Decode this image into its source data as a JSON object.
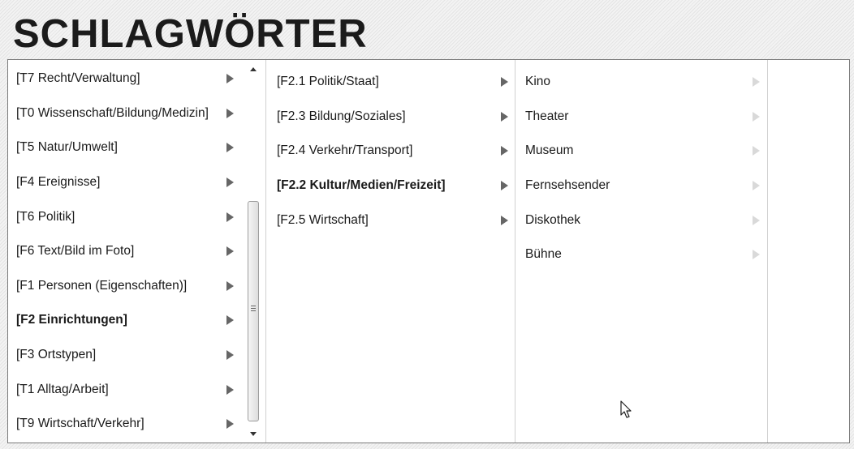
{
  "header": {
    "title": "SCHLAGWÖRTER"
  },
  "columns": {
    "level1": {
      "items": [
        {
          "label": "[T7 Recht/Verwaltung]",
          "bold": false
        },
        {
          "label": "[T0 Wissenschaft/Bildung/Medizin]",
          "bold": false
        },
        {
          "label": "[T5 Natur/Umwelt]",
          "bold": false
        },
        {
          "label": "[F4 Ereignisse]",
          "bold": false
        },
        {
          "label": "[T6 Politik]",
          "bold": false
        },
        {
          "label": "[F6 Text/Bild im Foto]",
          "bold": false
        },
        {
          "label": "[F1 Personen (Eigenschaften)]",
          "bold": false
        },
        {
          "label": "[F2 Einrichtungen]",
          "bold": true
        },
        {
          "label": "[F3 Ortstypen]",
          "bold": false
        },
        {
          "label": "[T1 Alltag/Arbeit]",
          "bold": false
        },
        {
          "label": "[T9 Wirtschaft/Verkehr]",
          "bold": false
        }
      ]
    },
    "level2": {
      "items": [
        {
          "label": "[F2.1 Politik/Staat]",
          "bold": false
        },
        {
          "label": "[F2.3 Bildung/Soziales]",
          "bold": false
        },
        {
          "label": "[F2.4 Verkehr/Transport]",
          "bold": false
        },
        {
          "label": "[F2.2 Kultur/Medien/Freizeit]",
          "bold": true
        },
        {
          "label": "[F2.5 Wirtschaft]",
          "bold": false
        }
      ]
    },
    "level3": {
      "items": [
        {
          "label": "Kino"
        },
        {
          "label": "Theater"
        },
        {
          "label": "Museum"
        },
        {
          "label": "Fernsehsender"
        },
        {
          "label": "Diskothek"
        },
        {
          "label": "Bühne"
        }
      ]
    }
  },
  "icons": {
    "submenu_arrow": "triangle-right-icon",
    "scroll_up": "scroll-up-arrow-icon",
    "scroll_down": "scroll-down-arrow-icon",
    "grip": "scroll-grip-icon",
    "cursor": "mouse-pointer-icon"
  },
  "colors": {
    "title": "#1b1b1b",
    "text": "#1a1a1a",
    "arrow_active": "#666666",
    "arrow_inactive": "#d9d9d9",
    "panel_border": "#7a7a7a"
  }
}
